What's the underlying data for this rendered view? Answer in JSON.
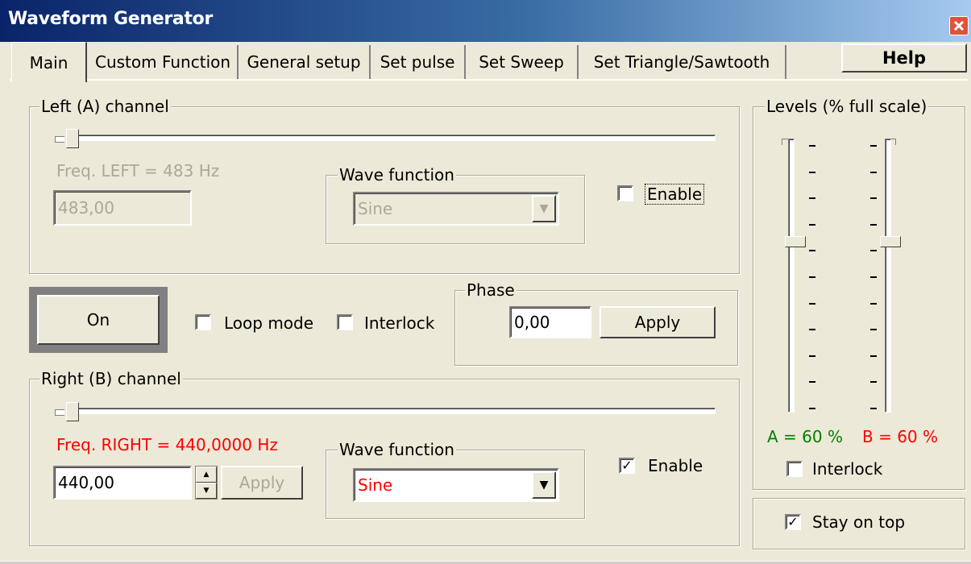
{
  "window": {
    "title": "Waveform Generator"
  },
  "tabs": [
    {
      "label": "Main"
    },
    {
      "label": "Custom Function"
    },
    {
      "label": "General setup"
    },
    {
      "label": "Set pulse"
    },
    {
      "label": "Set Sweep"
    },
    {
      "label": "Set Triangle/Sawtooth"
    }
  ],
  "help_label": "Help",
  "left_channel": {
    "legend": "Left (A) channel",
    "freq_label": "Freq. LEFT = 483 Hz",
    "freq_value": "483,00",
    "wave_legend": "Wave function",
    "wave_value": "Sine",
    "enable_label": "Enable",
    "enabled": false
  },
  "controls": {
    "on_label": "On",
    "loop_mode_label": "Loop mode",
    "interlock_label": "Interlock"
  },
  "phase": {
    "legend": "Phase",
    "value": "0,00",
    "apply_label": "Apply"
  },
  "right_channel": {
    "legend": "Right (B) channel",
    "freq_label": "Freq. RIGHT = 440,0000 Hz",
    "freq_value": "440,00",
    "apply_label": "Apply",
    "wave_legend": "Wave function",
    "wave_value": "Sine",
    "enable_label": "Enable",
    "enabled": true
  },
  "levels": {
    "legend": "Levels (% full scale)",
    "a_label": "A = 60 %",
    "b_label": "B = 60 %",
    "a_value": 0.6,
    "b_value": 0.6,
    "interlock_label": "Interlock"
  },
  "stay_on_top": {
    "label": "Stay on top",
    "checked": true
  },
  "colors": {
    "disabled_text": "#ACA899",
    "right_freq": "#FF0000",
    "level_a": "#008000",
    "level_b": "#FF0000"
  }
}
